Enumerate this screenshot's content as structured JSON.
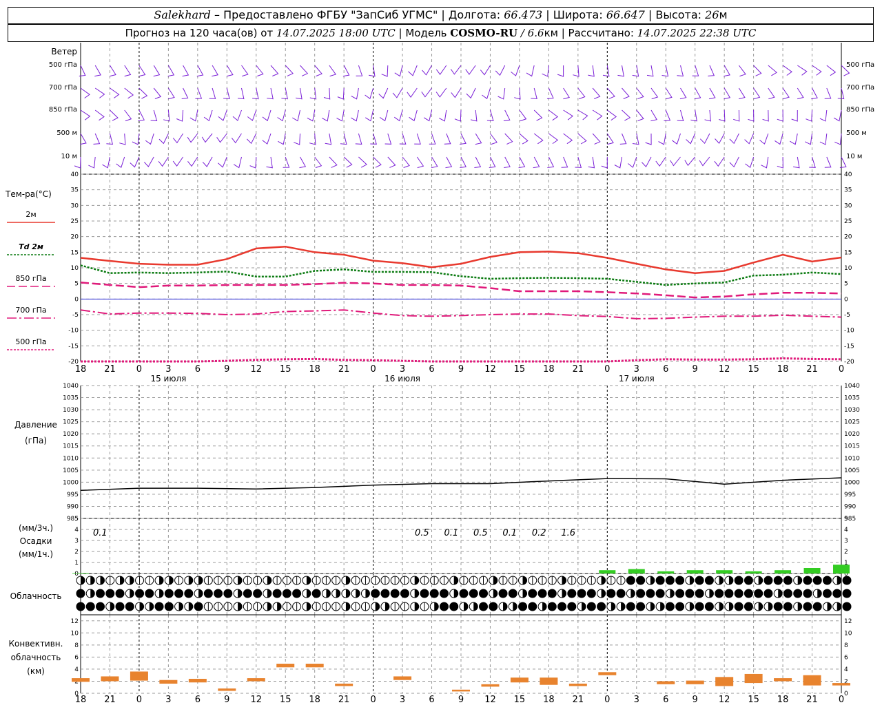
{
  "header": {
    "station": "Salekhard",
    "provider": " – Предоставлено ФГБУ \"ЗапСиб УГМС\" | Долгота: ",
    "lon": "66.473",
    "lat_label": " | Широта: ",
    "lat": "66.647",
    "alt_label": " | Высота: ",
    "alt": "26",
    "alt_unit": "м",
    "line2_a": "Прогноз на 120 часа(ов) от ",
    "run_time": "14.07.2025 18:00 UTC",
    "line2_b": " | Модель ",
    "model": "COSMO-RU",
    "res": " / 6.6",
    "res_unit": "км",
    "line2_c": " | Рассчитано: ",
    "calc_time": "14.07.2025 22:38 UTC"
  },
  "wind": {
    "title": "Ветер",
    "levels": [
      "500 гПа",
      "700 гПа",
      "850 гПа",
      "500 м",
      "10  м"
    ]
  },
  "temperature": {
    "title": "Тем-ра(°C)",
    "legend": [
      {
        "label": "2м",
        "color": "#e8392e",
        "style": "solid"
      },
      {
        "label": "Td  2м",
        "color": "#0a7a10",
        "style": "dotted"
      },
      {
        "label": "850 гПа",
        "color": "#e0197a",
        "style": "dashed"
      },
      {
        "label": "700 гПа",
        "color": "#e0197a",
        "style": "dashdot"
      },
      {
        "label": "500 гПа",
        "color": "#e0197a",
        "style": "dotted"
      }
    ]
  },
  "pressure": {
    "title": "Давление",
    "unit": "(гПа)"
  },
  "precip": {
    "unit3": "(мм/3ч.)",
    "title": "Осадки",
    "unit1": "(мм/1ч.)",
    "totals": [
      {
        "x": 0,
        "label": "0.1"
      },
      {
        "x": 33,
        "label": "0.5"
      },
      {
        "x": 36,
        "label": "0.1"
      },
      {
        "x": 39,
        "label": "0.5"
      },
      {
        "x": 42,
        "label": "0.1"
      },
      {
        "x": 45,
        "label": "0.2"
      },
      {
        "x": 48,
        "label": "1.6"
      }
    ]
  },
  "clouds": {
    "title": "Облачность"
  },
  "convective": {
    "title_1": "Конвективн.",
    "title_2": "облачность",
    "unit": "(км)"
  },
  "dates": [
    {
      "x": 9,
      "label": "15 июля"
    },
    {
      "x": 33,
      "label": "16 июля"
    },
    {
      "x": 57,
      "label": "17 июля"
    }
  ],
  "hour_labels": [
    "18",
    "21",
    "0",
    "3",
    "6",
    "9",
    "12",
    "15",
    "18",
    "21",
    "0",
    "3",
    "6",
    "9",
    "12",
    "15",
    "18",
    "21",
    "0",
    "3",
    "6",
    "9",
    "12",
    "15",
    "18",
    "21",
    "0"
  ],
  "chart_data": [
    {
      "type": "line",
      "panel": "temperature",
      "x_unit": "hours since 14.07 18:00 UTC",
      "ylim": [
        -20,
        40
      ],
      "y_ticks": [
        40,
        35,
        30,
        25,
        20,
        15,
        10,
        5,
        0,
        -5,
        -10,
        -15,
        -20
      ],
      "x": [
        0,
        3,
        6,
        9,
        12,
        15,
        18,
        21,
        24,
        27,
        30,
        33,
        36,
        39,
        42,
        45,
        48,
        51,
        54,
        57,
        60,
        63,
        66,
        69,
        72,
        75,
        78
      ],
      "series": [
        {
          "name": "2м",
          "values": [
            13.2,
            12.2,
            11.3,
            11,
            11,
            12.8,
            16.2,
            16.8,
            15,
            14.2,
            12.3,
            11.5,
            10.2,
            11.3,
            13.5,
            15,
            15.2,
            14.7,
            13.2,
            11.3,
            9.5,
            8.3,
            9,
            11.7,
            14.2,
            12,
            13.3
          ]
        },
        {
          "name": "Td 2м",
          "values": [
            10.8,
            8.3,
            8.5,
            8.3,
            8.5,
            8.8,
            7.2,
            7.2,
            9,
            9.5,
            8.7,
            8.7,
            8.6,
            7.3,
            6.5,
            6.7,
            6.8,
            6.7,
            6.5,
            5.5,
            4.5,
            5,
            5.3,
            7.5,
            7.8,
            8.5,
            8
          ]
        },
        {
          "name": "850 гПа",
          "values": [
            5.3,
            4.5,
            3.8,
            4.3,
            4.3,
            4.5,
            4.5,
            4.5,
            4.8,
            5.2,
            5,
            4.5,
            4.5,
            4.3,
            3.5,
            2.5,
            2.5,
            2.5,
            2.2,
            1.8,
            1.2,
            0.5,
            0.8,
            1.5,
            2,
            2,
            1.8
          ]
        },
        {
          "name": "700 гПа",
          "values": [
            -3.5,
            -4.8,
            -4.5,
            -4.5,
            -4.6,
            -5,
            -4.8,
            -4,
            -3.8,
            -3.5,
            -4.5,
            -5.3,
            -5.5,
            -5.3,
            -5,
            -4.8,
            -4.8,
            -5.3,
            -5.6,
            -6.3,
            -6.2,
            -5.8,
            -5.5,
            -5.5,
            -5.2,
            -5.5,
            -5.8
          ]
        },
        {
          "name": "500 гПа",
          "values": [
            -20,
            -20,
            -20,
            -20,
            -20,
            -19.8,
            -19.5,
            -19.3,
            -19.2,
            -19.5,
            -19.6,
            -19.8,
            -20,
            -20,
            -20,
            -20,
            -20,
            -20,
            -20,
            -19.6,
            -19.3,
            -19.4,
            -19.4,
            -19.3,
            -19,
            -19.2,
            -19.3
          ]
        }
      ]
    },
    {
      "type": "line",
      "panel": "pressure",
      "ylim": [
        985,
        1040
      ],
      "y_ticks": [
        1040,
        1035,
        1030,
        1025,
        1020,
        1015,
        1010,
        1005,
        1000,
        995,
        990,
        985
      ],
      "x": [
        0,
        6,
        12,
        18,
        24,
        30,
        36,
        42,
        48,
        54,
        60,
        66,
        72,
        78
      ],
      "series": [
        {
          "name": "",
          "values": [
            996.6,
            997.5,
            997.5,
            997.2,
            997.8,
            998.8,
            999.4,
            999.4,
            1000.5,
            1001.5,
            1001.4,
            999.2,
            1000.8,
            1001.8
          ]
        }
      ]
    },
    {
      "type": "bar",
      "panel": "precipitation",
      "ylim": [
        0,
        5
      ],
      "y_ticks": [
        5,
        4,
        3,
        2,
        1,
        0
      ],
      "x": [
        0,
        54,
        57,
        60,
        63,
        66,
        69,
        72,
        75,
        78
      ],
      "values": [
        0.05,
        0.3,
        0.4,
        0.2,
        0.3,
        0.3,
        0.2,
        0.3,
        0.5,
        0.8
      ]
    },
    {
      "type": "bar",
      "panel": "convective",
      "ylim": [
        0,
        13
      ],
      "y_ticks": [
        12,
        10,
        8,
        6,
        4,
        2,
        0
      ],
      "bars": [
        {
          "x": 0,
          "bottom": 1.9,
          "top": 2.5
        },
        {
          "x": 3,
          "bottom": 2.0,
          "top": 2.8
        },
        {
          "x": 6,
          "bottom": 2.1,
          "top": 3.6
        },
        {
          "x": 9,
          "bottom": 1.6,
          "top": 2.2
        },
        {
          "x": 12,
          "bottom": 1.8,
          "top": 2.4
        },
        {
          "x": 15,
          "bottom": 0.4,
          "top": 0.8
        },
        {
          "x": 18,
          "bottom": 2.0,
          "top": 2.5
        },
        {
          "x": 21,
          "bottom": 4.3,
          "top": 4.9
        },
        {
          "x": 24,
          "bottom": 4.3,
          "top": 4.9
        },
        {
          "x": 27,
          "bottom": 1.2,
          "top": 1.6
        },
        {
          "x": 33,
          "bottom": 2.2,
          "top": 2.8
        },
        {
          "x": 39,
          "bottom": 0.3,
          "top": 0.6
        },
        {
          "x": 42,
          "bottom": 1.1,
          "top": 1.5
        },
        {
          "x": 45,
          "bottom": 1.8,
          "top": 2.6
        },
        {
          "x": 48,
          "bottom": 1.4,
          "top": 2.6
        },
        {
          "x": 51,
          "bottom": 1.2,
          "top": 1.6
        },
        {
          "x": 54,
          "bottom": 3.0,
          "top": 3.5
        },
        {
          "x": 60,
          "bottom": 1.5,
          "top": 2.0
        },
        {
          "x": 63,
          "bottom": 1.5,
          "top": 2.1
        },
        {
          "x": 66,
          "bottom": 1.2,
          "top": 2.7
        },
        {
          "x": 69,
          "bottom": 1.7,
          "top": 3.2
        },
        {
          "x": 72,
          "bottom": 2.0,
          "top": 2.5
        },
        {
          "x": 75,
          "bottom": 1.3,
          "top": 3.0
        },
        {
          "x": 78,
          "bottom": 1.3,
          "top": 1.7
        }
      ]
    }
  ],
  "colors": {
    "wind": "#7a1fd6",
    "t2m": "#e8392e",
    "td": "#0a7a10",
    "levels": "#e0197a",
    "pressure": "#000000",
    "precip": "#33cc22",
    "convective": "#e8832e",
    "grid": "#999999",
    "zero_line": "#2a2ad4"
  }
}
